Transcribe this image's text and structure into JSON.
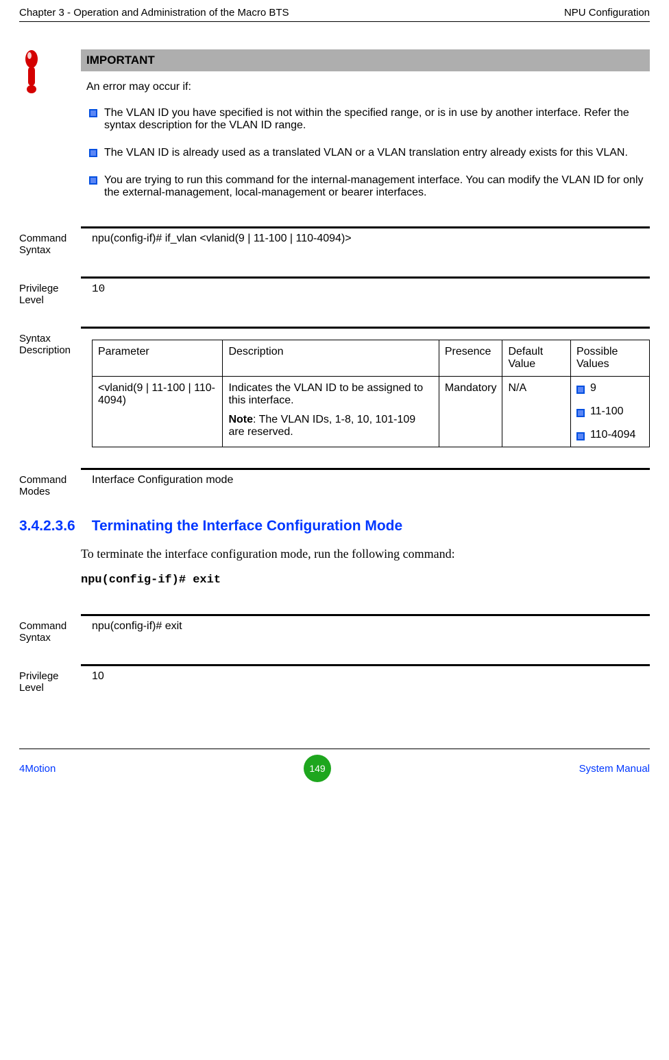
{
  "header": {
    "left": "Chapter 3 - Operation and Administration of the Macro BTS",
    "right": "NPU Configuration"
  },
  "important": {
    "title": "IMPORTANT",
    "intro": "An error may occur if:",
    "bullets": [
      "The VLAN ID you have specified is not within the specified range, or is in use by another interface. Refer the syntax description for the VLAN ID range.",
      "The VLAN ID is already used as a translated VLAN or a VLAN translation entry already exists for this VLAN.",
      "You are trying to run this command for the internal-management interface. You can modify the VLAN ID for only the external-management, local-management or bearer interfaces."
    ]
  },
  "cmd1": {
    "syntax_label": "Command Syntax",
    "syntax_value": "npu(config-if)# if_vlan <vlanid(9 | 11-100 | 110-4094)>",
    "priv_label": "Privilege Level",
    "priv_value": "10",
    "syndesc_label": "Syntax Description",
    "table": {
      "headers": {
        "param": "Parameter",
        "desc": "Description",
        "presence": "Presence",
        "default": "Default Value",
        "possible": "Possible Values"
      },
      "row": {
        "param": "<vlanid(9 | 11-100 | 110-4094)",
        "desc_main": "Indicates the VLAN ID to be assigned to this interface.",
        "note_label": "Note",
        "note_text": ": The VLAN IDs, 1-8, 10, 101-109 are reserved.",
        "presence": "Mandatory",
        "default": "N/A",
        "pv": [
          "9",
          "11-100",
          "110-4094"
        ]
      }
    },
    "modes_label": "Command Modes",
    "modes_value": "Interface Configuration mode"
  },
  "section": {
    "number": "3.4.2.3.6",
    "title": "Terminating the Interface Configuration Mode",
    "para": "To terminate the interface configuration mode, run the following command:",
    "cmd": "npu(config-if)# exit"
  },
  "cmd2": {
    "syntax_label": "Command Syntax",
    "syntax_value": "npu(config-if)# exit",
    "priv_label": "Privilege Level",
    "priv_value": "10"
  },
  "footer": {
    "left": "4Motion",
    "page": "149",
    "right": "System Manual"
  }
}
